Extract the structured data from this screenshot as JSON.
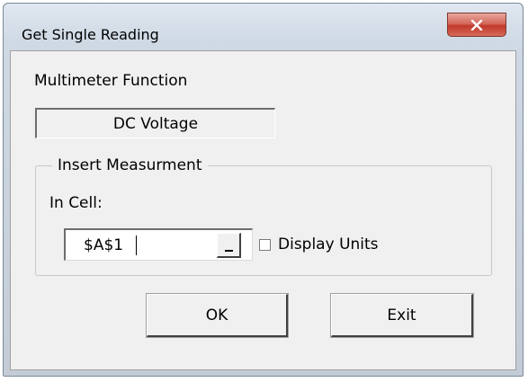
{
  "window": {
    "title": "Get Single Reading",
    "close_icon": "close-x-icon",
    "close_color": "#c0392b"
  },
  "function_section": {
    "label": "Multimeter Function",
    "value": "DC Voltage"
  },
  "insert_group": {
    "legend": "Insert Measurment",
    "in_cell_label": "In Cell:",
    "cell_value": "$A$1",
    "ref_button_icon": "range-select-icon",
    "display_units_label": "Display Units",
    "display_units_checked": false
  },
  "buttons": {
    "ok_label": "OK",
    "exit_label": "Exit"
  }
}
